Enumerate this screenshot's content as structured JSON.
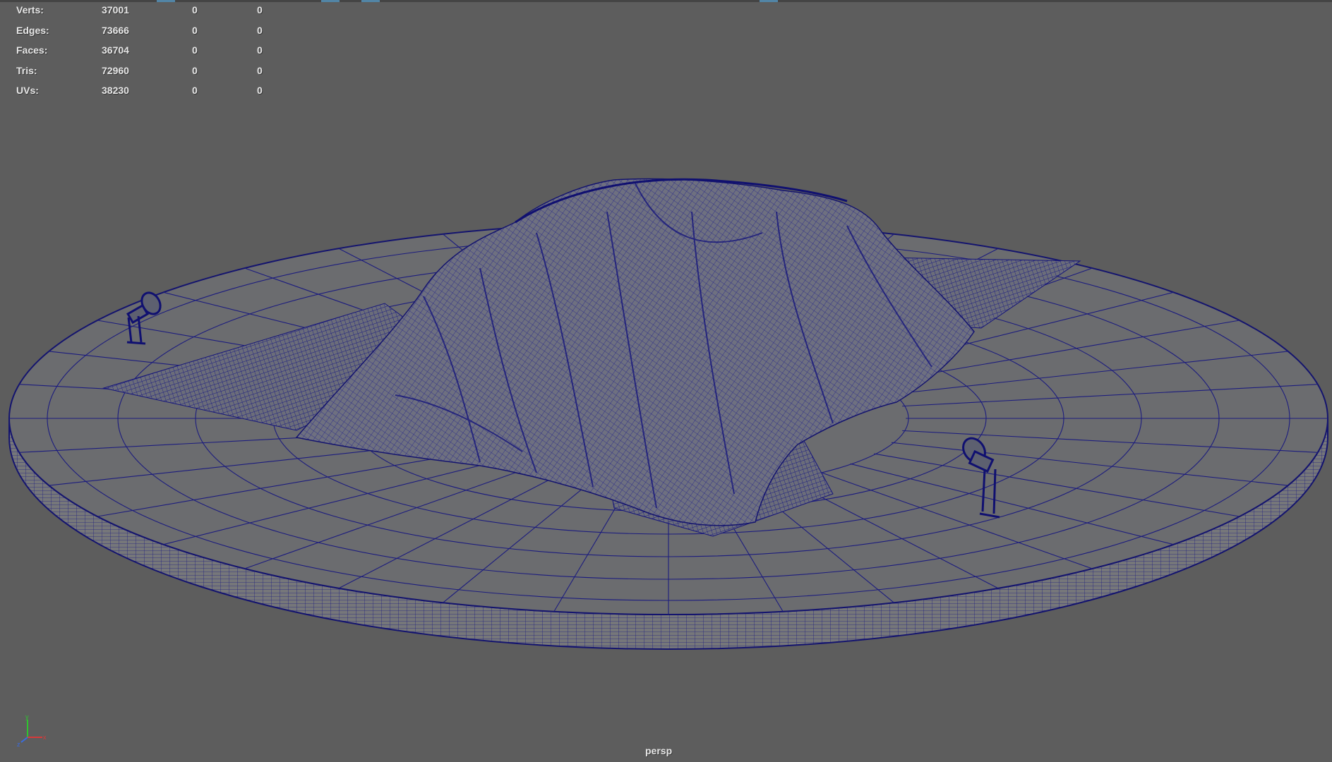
{
  "hud": {
    "rows": [
      {
        "label": "Verts:",
        "count": "37001",
        "sel1": "0",
        "sel2": "0"
      },
      {
        "label": "Edges:",
        "count": "73666",
        "sel1": "0",
        "sel2": "0"
      },
      {
        "label": "Faces:",
        "count": "36704",
        "sel1": "0",
        "sel2": "0"
      },
      {
        "label": "Tris:",
        "count": "72960",
        "sel1": "0",
        "sel2": "0"
      },
      {
        "label": "UVs:",
        "count": "38230",
        "sel1": "0",
        "sel2": "0"
      }
    ]
  },
  "viewport": {
    "camera_label": "persp",
    "background": "#5d5d5d",
    "wire_color": "#1a1a7a",
    "wire_dense_color": "#22227e",
    "surface_color": "#6a6c70",
    "cloth_color": "#6a6c78"
  },
  "axis_gizmo": {
    "x": "x",
    "y": "y",
    "z": "z"
  }
}
